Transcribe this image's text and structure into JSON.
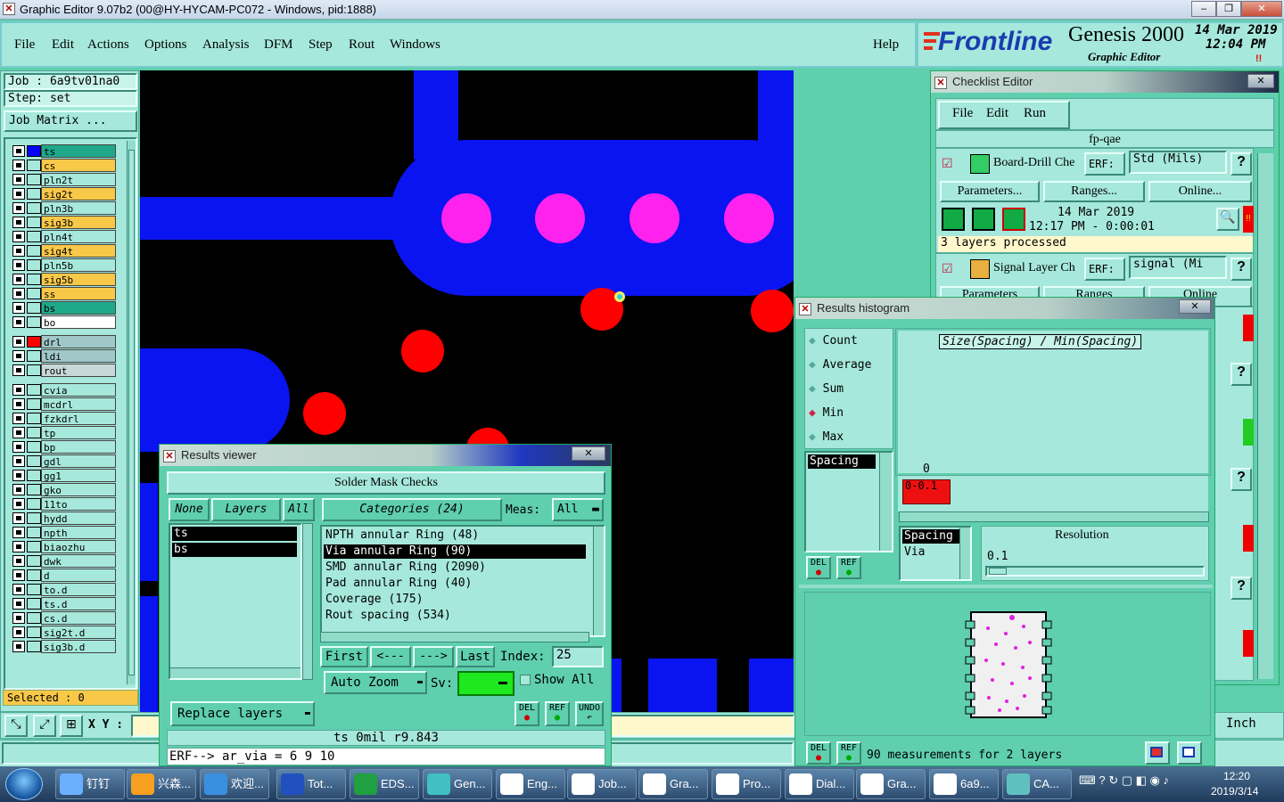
{
  "window": {
    "title": "Graphic Editor 9.07b2 (00@HY-HYCAM-PC072 - Windows, pid:1888)"
  },
  "menu": [
    "File",
    "Edit",
    "Actions",
    "Options",
    "Analysis",
    "DFM",
    "Step",
    "Rout",
    "Windows"
  ],
  "help": "Help",
  "brand": {
    "logo": "Frontline",
    "product": "Genesis 2000",
    "subtitle": "Graphic Editor",
    "date": "14 Mar 2019",
    "time": "12:04 PM",
    "alert": "!!"
  },
  "job": {
    "job_label": "Job : 6a9tv01na0",
    "step_label": "Step: set",
    "matrix_button": "Job Matrix ..."
  },
  "layers": [
    {
      "name": "ts",
      "color": "#1fa88a",
      "swatch": "#0000ff"
    },
    {
      "name": "cs",
      "color": "#f8c848",
      "swatch": ""
    },
    {
      "name": "pln2t",
      "color": "#a6e8dc",
      "swatch": ""
    },
    {
      "name": "sig2t",
      "color": "#f8c848",
      "swatch": ""
    },
    {
      "name": "pln3b",
      "color": "#a6e8dc",
      "swatch": ""
    },
    {
      "name": "sig3b",
      "color": "#f8c848",
      "swatch": ""
    },
    {
      "name": "pln4t",
      "color": "#a6e8dc",
      "swatch": ""
    },
    {
      "name": "sig4t",
      "color": "#f8c848",
      "swatch": ""
    },
    {
      "name": "pln5b",
      "color": "#a6e8dc",
      "swatch": ""
    },
    {
      "name": "sig5b",
      "color": "#f8c848",
      "swatch": ""
    },
    {
      "name": "ss",
      "color": "#f8c848",
      "swatch": ""
    },
    {
      "name": "bs",
      "color": "#1fa88a",
      "swatch": ""
    },
    {
      "name": "bo",
      "color": "#ffffff",
      "swatch": ""
    },
    {
      "name": "drl",
      "color": "#a0c8c8",
      "swatch": "#ff0000"
    },
    {
      "name": "ldi",
      "color": "#a0c8c8",
      "swatch": ""
    },
    {
      "name": "rout",
      "color": "#c8d8d8",
      "swatch": ""
    },
    {
      "name": "cvia",
      "color": "#a6e8dc",
      "swatch": ""
    },
    {
      "name": "mcdrl",
      "color": "#a6e8dc",
      "swatch": ""
    },
    {
      "name": "fzkdrl",
      "color": "#a6e8dc",
      "swatch": ""
    },
    {
      "name": "tp",
      "color": "#a6e8dc",
      "swatch": ""
    },
    {
      "name": "bp",
      "color": "#a6e8dc",
      "swatch": ""
    },
    {
      "name": "gdl",
      "color": "#a6e8dc",
      "swatch": ""
    },
    {
      "name": "gg1",
      "color": "#a6e8dc",
      "swatch": ""
    },
    {
      "name": "gko",
      "color": "#a6e8dc",
      "swatch": ""
    },
    {
      "name": "11to",
      "color": "#a6e8dc",
      "swatch": ""
    },
    {
      "name": "hydd",
      "color": "#a6e8dc",
      "swatch": ""
    },
    {
      "name": "npth",
      "color": "#a6e8dc",
      "swatch": ""
    },
    {
      "name": "biaozhu",
      "color": "#a6e8dc",
      "swatch": ""
    },
    {
      "name": "dwk",
      "color": "#a6e8dc",
      "swatch": ""
    },
    {
      "name": "d",
      "color": "#a6e8dc",
      "swatch": ""
    },
    {
      "name": "to.d",
      "color": "#a6e8dc",
      "swatch": ""
    },
    {
      "name": "ts.d",
      "color": "#a6e8dc",
      "swatch": ""
    },
    {
      "name": "cs.d",
      "color": "#a6e8dc",
      "swatch": ""
    },
    {
      "name": "sig2t.d",
      "color": "#a6e8dc",
      "swatch": ""
    },
    {
      "name": "sig3b.d",
      "color": "#a6e8dc",
      "swatch": ""
    }
  ],
  "selected": "Selected : 0",
  "xy_label": "X Y :",
  "checklist": {
    "title": "Checklist Editor",
    "menu": [
      "File",
      "Edit",
      "Run"
    ],
    "name": "fp-qae",
    "item1": {
      "name": "Board-Drill Che",
      "erf": "ERF:",
      "erf_value": "Std (Mils)",
      "help": "?",
      "params": "Parameters...",
      "ranges": "Ranges...",
      "online": "Online...",
      "date": "14 Mar 2019",
      "time": "12:17 PM - 0:00:01",
      "status": "3 layers processed",
      "alert": "!!"
    },
    "item2": {
      "name": "Signal Layer Ch",
      "erf": "ERF:",
      "erf_value": "signal (Mi",
      "help": "?",
      "params": "Parameters",
      "ranges": "Ranges",
      "online": "Online"
    },
    "help_buttons": [
      "?",
      "?",
      "?"
    ],
    "inch": "Inch"
  },
  "results_viewer": {
    "title": "Results viewer",
    "heading": "Solder Mask Checks",
    "none": "None",
    "layers_btn": "Layers",
    "all_btn": "All",
    "categories_btn": "Categories (24)",
    "meas_label": "Meas:",
    "meas_value": "All",
    "layer_items": [
      "ts",
      "bs"
    ],
    "categories": [
      "NPTH annular Ring (48)",
      "Via annular Ring (90)",
      "SMD annular Ring (2090)",
      "Pad annular Ring (40)",
      "Coverage (175)",
      "Rout spacing (534)"
    ],
    "selected_category": 1,
    "first": "First",
    "prev": "<---",
    "next": "--->",
    "last": "Last",
    "index_label": "Index:",
    "index_value": "25",
    "auto_zoom": "Auto Zoom",
    "sv_label": "Sv:",
    "show_all": "Show All",
    "replace_layers": "Replace layers",
    "del": "DEL",
    "ref": "REF",
    "undo": "UNDO",
    "status": "ts 0mil r9.843",
    "erf_line": "ERF--> ar_via = 6 9 10"
  },
  "histogram": {
    "title": "Results histogram",
    "options": [
      "Count",
      "Average",
      "Sum",
      "Min",
      "Max"
    ],
    "selected_option": "Min",
    "graph_title": "Size(Spacing) / Min(Spacing)",
    "zero": "0",
    "bar_label": "0-0.1",
    "list1": [
      "Spacing"
    ],
    "list2": [
      "Spacing",
      "Via"
    ],
    "resolution_label": "Resolution",
    "resolution_value": "0.1",
    "del": "DEL",
    "ref": "REF",
    "status": "90 measurements for 2 layers"
  },
  "taskbar": {
    "items": [
      "钉钉",
      "兴森...",
      "欢迎...",
      "Tot...",
      "EDS...",
      "Gen...",
      "Eng...",
      "Job...",
      "Gra...",
      "Pro...",
      "Dial...",
      "Gra...",
      "6a9...",
      "CA..."
    ],
    "time": "12:20",
    "date": "2019/3/14"
  }
}
